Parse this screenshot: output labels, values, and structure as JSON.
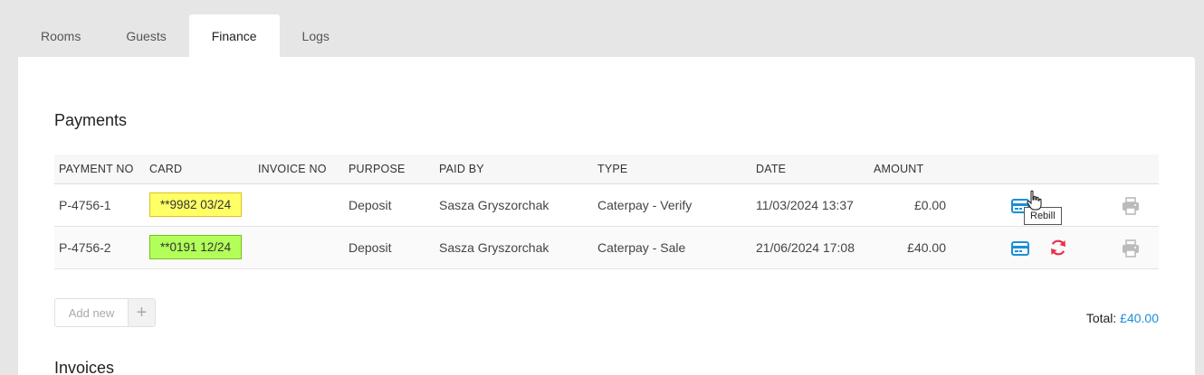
{
  "tabs": [
    {
      "label": "Rooms",
      "active": false
    },
    {
      "label": "Guests",
      "active": false
    },
    {
      "label": "Finance",
      "active": true
    },
    {
      "label": "Logs",
      "active": false
    }
  ],
  "payments": {
    "title": "Payments",
    "columns": [
      "PAYMENT NO",
      "CARD",
      "INVOICE NO",
      "PURPOSE",
      "PAID BY",
      "TYPE",
      "DATE",
      "AMOUNT"
    ],
    "rows": [
      {
        "payment_no": "P-4756-1",
        "card": "**9982 03/24",
        "card_color": "#ffff66",
        "invoice_no": "",
        "purpose": "Deposit",
        "paid_by": "Sasza Gryszorchak",
        "type": "Caterpay - Verify",
        "date": "11/03/2024 13:37",
        "amount": "£0.00",
        "actions": [
          "card-icon",
          "print-icon"
        ]
      },
      {
        "payment_no": "P-4756-2",
        "card": "**0191 12/24",
        "card_color": "#b2ff59",
        "invoice_no": "",
        "purpose": "Deposit",
        "paid_by": "Sasza Gryszorchak",
        "type": "Caterpay - Sale",
        "date": "21/06/2024 17:08",
        "amount": "£40.00",
        "actions": [
          "card-icon",
          "refresh-icon",
          "print-icon"
        ]
      }
    ],
    "tooltip": "Rebill",
    "add_new_label": "Add new",
    "add_new_icon": "+",
    "total_label": "Total:",
    "total_value": "£40.00"
  },
  "invoices": {
    "title": "Invoices"
  },
  "colors": {
    "accent": "#1a8fd6",
    "danger": "#e8334a",
    "muted_icon": "#bbbbbb"
  }
}
